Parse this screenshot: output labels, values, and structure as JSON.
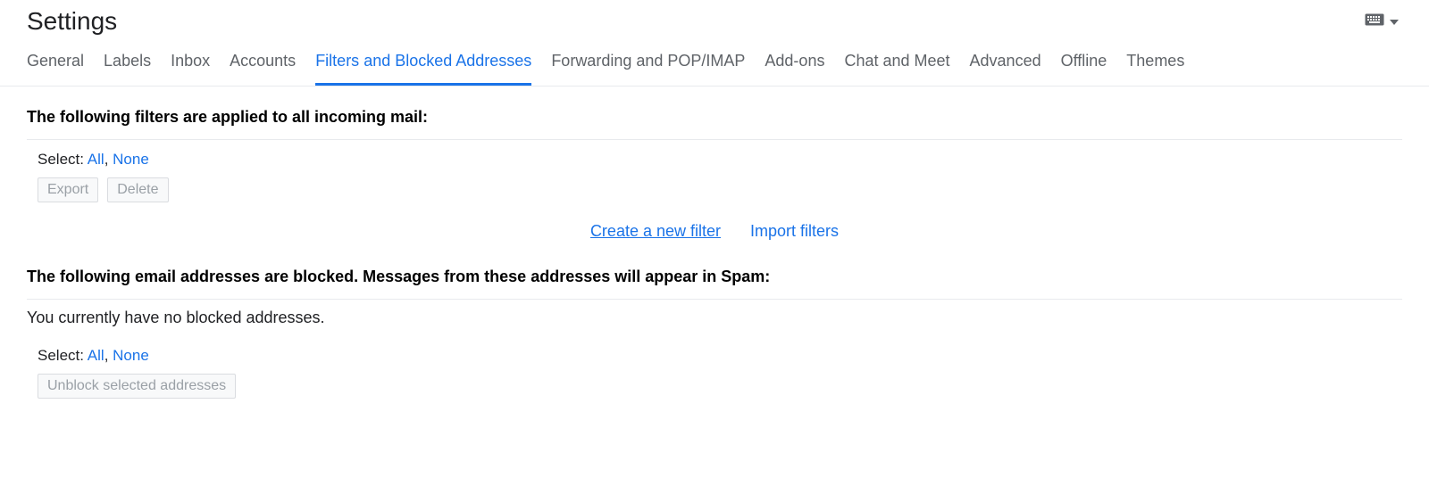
{
  "header": {
    "title": "Settings"
  },
  "tabs": [
    {
      "label": "General"
    },
    {
      "label": "Labels"
    },
    {
      "label": "Inbox"
    },
    {
      "label": "Accounts"
    },
    {
      "label": "Filters and Blocked Addresses",
      "active": true
    },
    {
      "label": "Forwarding and POP/IMAP"
    },
    {
      "label": "Add-ons"
    },
    {
      "label": "Chat and Meet"
    },
    {
      "label": "Advanced"
    },
    {
      "label": "Offline"
    },
    {
      "label": "Themes"
    }
  ],
  "filters": {
    "heading": "The following filters are applied to all incoming mail:",
    "select_label": "Select:",
    "select_all": "All",
    "select_none": "None",
    "export_button": "Export",
    "delete_button": "Delete",
    "create_link": "Create a new filter",
    "import_link": "Import filters"
  },
  "blocked": {
    "heading": "The following email addresses are blocked. Messages from these addresses will appear in Spam:",
    "empty_message": "You currently have no blocked addresses.",
    "select_label": "Select:",
    "select_all": "All",
    "select_none": "None",
    "unblock_button": "Unblock selected addresses"
  }
}
